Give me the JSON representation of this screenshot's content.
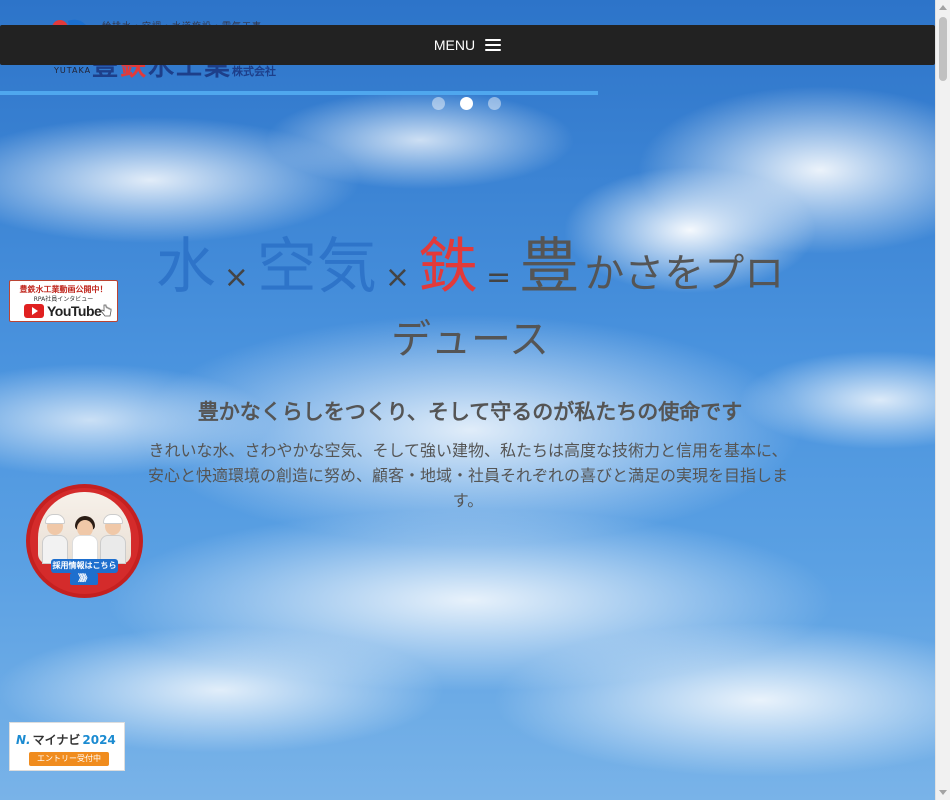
{
  "logo": {
    "tagline": "給排水・空調・水道施設・電気工事",
    "name_part1": "豊",
    "name_part2": "鉄",
    "name_part3": "水工業",
    "name_suffix": "株式会社",
    "roman": "YUTAKA"
  },
  "menu": {
    "label": "MENU"
  },
  "slider": {
    "progress": 0.64,
    "dots": 3,
    "active_index": 1
  },
  "hero": {
    "word_water": "水",
    "op_times_1": "×",
    "word_air": "空気",
    "op_times_2": "×",
    "word_iron": "鉄",
    "op_equals": "=",
    "word_rich": "豊",
    "tail": "かさをプロデュース",
    "subheading": "豊かなくらしをつくり、そして守るのが私たちの使命です",
    "description": "きれいな水、さわやかな空気、そして強い建物、私たちは高度な技術力と信用を基本に、安心と快適環境の創造に努め、顧客・地域・社員それぞれの喜びと満足の実現を目指します。"
  },
  "youtube_banner": {
    "line1": "豊鉄水工業動画公開中！",
    "line2": "RPA社員インタビュー",
    "brand": "YouTube"
  },
  "recruit_badge": {
    "label": "採用情報はこちら",
    "arrows": "》》》"
  },
  "mynavi": {
    "mark": "N.",
    "name": "マイナビ",
    "year": "2024",
    "entry": "エントリー受付中"
  },
  "colors": {
    "blue": "#2e74c9",
    "red": "#e23a3a",
    "menu_bg": "#222222",
    "progress": "#4fa7ee"
  }
}
